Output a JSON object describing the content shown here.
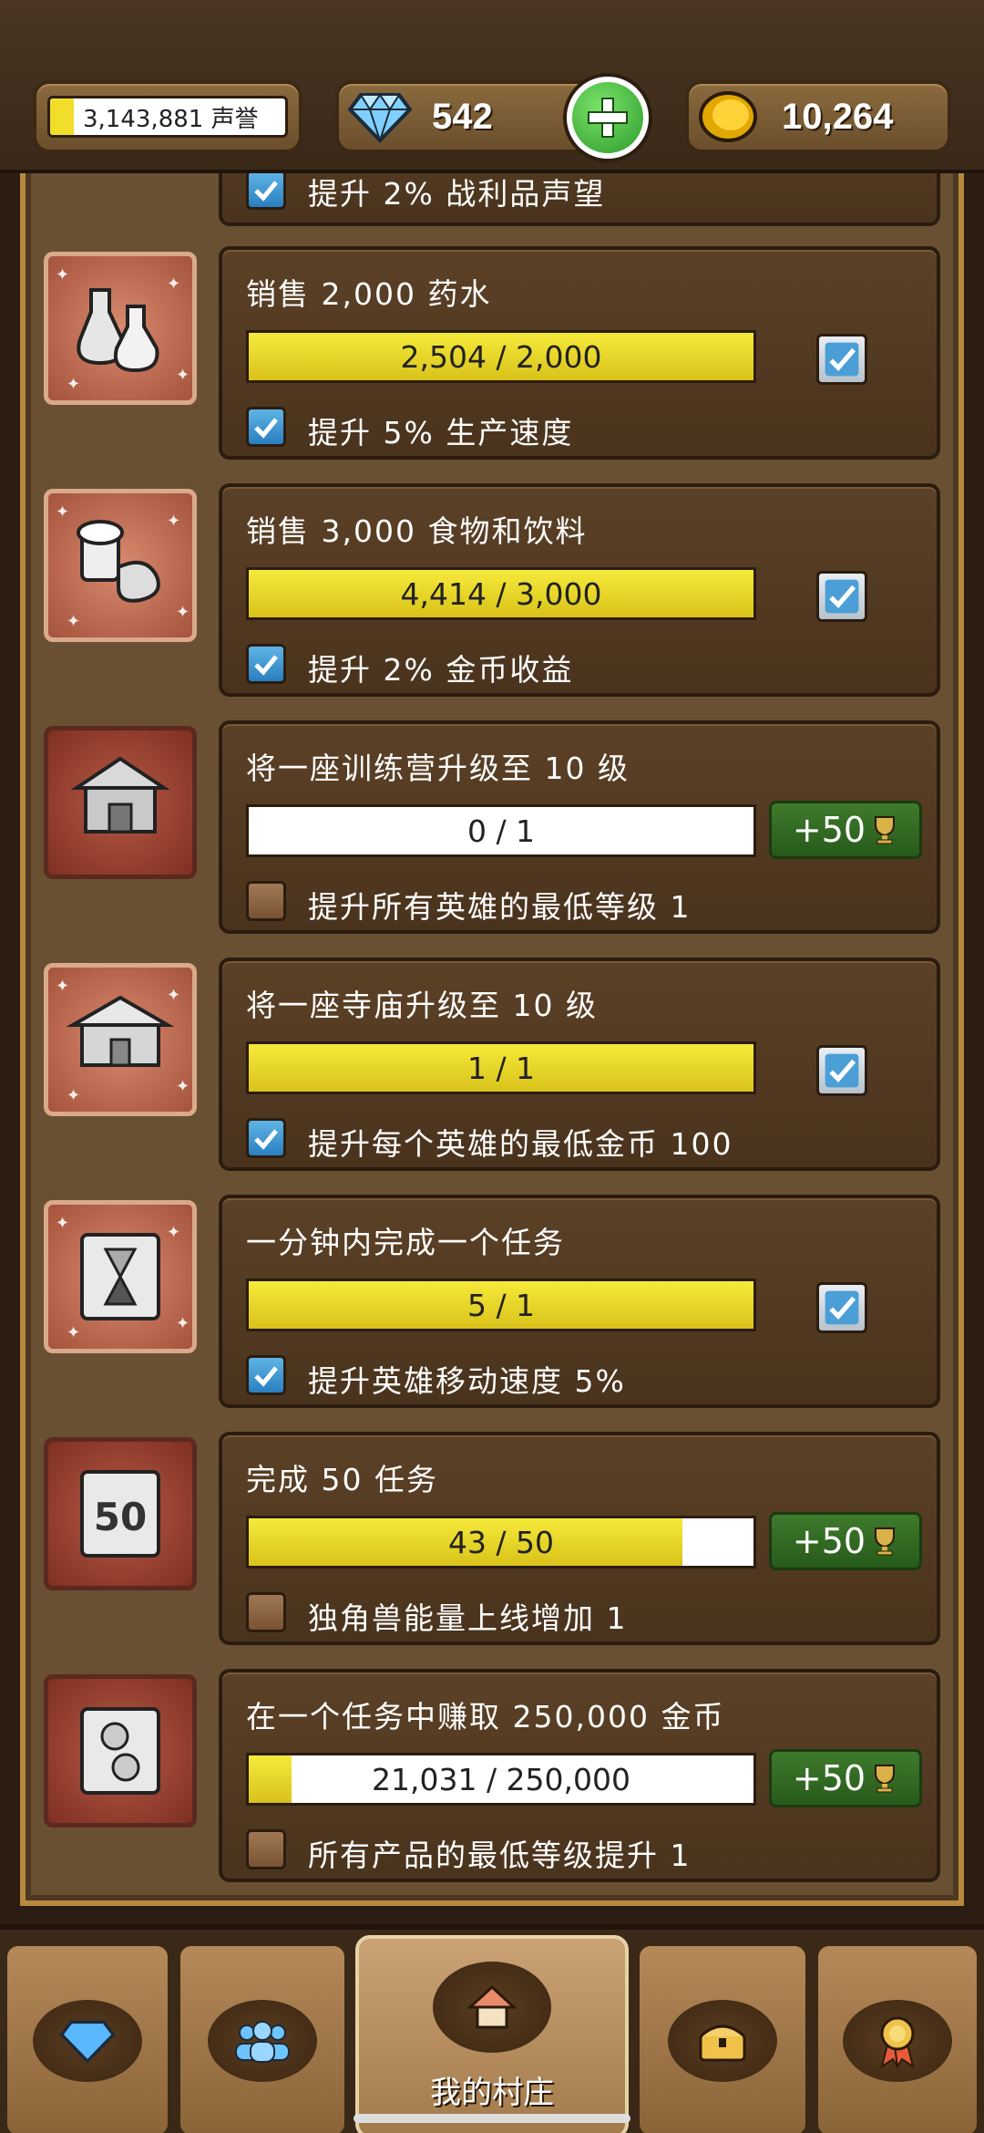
{
  "top_bar": {
    "fame_text": "3,143,881 声誉",
    "gems": "542",
    "gold": "10,264"
  },
  "partial_row": {
    "sub_text": "提升 2% 战利品声望"
  },
  "achievements": [
    {
      "title": "销售 2,000 药水",
      "progress": "2,504 / 2,000",
      "fill": 1.0,
      "completed": true,
      "sub_text": "提升 5% 生产速度",
      "icon": "potion-flasks-icon"
    },
    {
      "title": "销售 3,000 食物和饮料",
      "progress": "4,414 / 3,000",
      "fill": 1.0,
      "completed": true,
      "sub_text": "提升 2% 金币收益",
      "icon": "food-drink-icon"
    },
    {
      "title": "将一座训练营升级至 10 级",
      "progress": "0 / 1",
      "fill": 0.0,
      "completed": false,
      "reward": "+50",
      "sub_text": "提升所有英雄的最低等级 1",
      "icon": "training-camp-icon"
    },
    {
      "title": "将一座寺庙升级至 10 级",
      "progress": "1 / 1",
      "fill": 1.0,
      "completed": true,
      "sub_text": "提升每个英雄的最低金币 100",
      "icon": "temple-icon"
    },
    {
      "title": "一分钟内完成一个任务",
      "progress": "5 / 1",
      "fill": 1.0,
      "completed": true,
      "sub_text": "提升英雄移动速度 5%",
      "icon": "hourglass-scroll-icon"
    },
    {
      "title": "完成 50 任务",
      "progress": "43 / 50",
      "fill": 0.86,
      "completed": false,
      "reward": "+50",
      "sub_text": "独角兽能量上线增加 1",
      "icon": "fifty-scroll-icon"
    },
    {
      "title": "在一个任务中赚取 250,000 金币",
      "progress": "21,031 / 250,000",
      "fill": 0.084,
      "completed": false,
      "reward": "+50",
      "sub_text": "所有产品的最低等级提升 1",
      "icon": "coins-scroll-icon"
    }
  ],
  "bottom_nav": {
    "active_label": "我的村庄"
  }
}
